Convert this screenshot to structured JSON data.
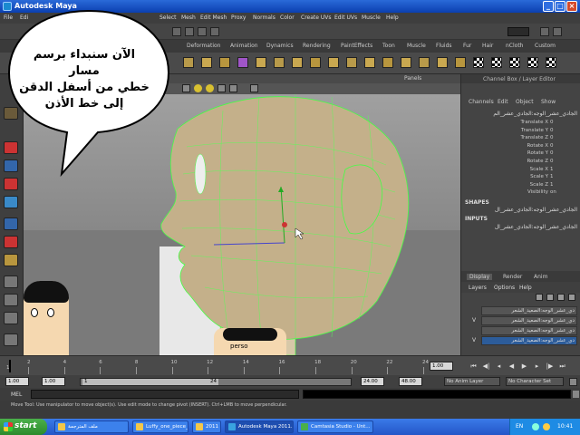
{
  "window": {
    "title": "Autodesk Maya"
  },
  "menu": [
    {
      "label": "File"
    },
    {
      "label": "Edi"
    },
    {
      "label": "Select"
    },
    {
      "label": "Mesh"
    },
    {
      "label": "Edit Mesh"
    },
    {
      "label": "Proxy"
    },
    {
      "label": "Normals"
    },
    {
      "label": "Color"
    },
    {
      "label": "Create UVs"
    },
    {
      "label": "Edit UVs"
    },
    {
      "label": "Muscle"
    },
    {
      "label": "Help"
    }
  ],
  "shelf_tabs": [
    {
      "label": "Deformation"
    },
    {
      "label": "Animation"
    },
    {
      "label": "Dynamics"
    },
    {
      "label": "Rendering"
    },
    {
      "label": "PaintEffects"
    },
    {
      "label": "Toon"
    },
    {
      "label": "Muscle"
    },
    {
      "label": "Fluids"
    },
    {
      "label": "Fur"
    },
    {
      "label": "Hair"
    },
    {
      "label": "nCloth"
    },
    {
      "label": "Custom"
    }
  ],
  "bubble": {
    "line1": "الآن سنبداء برسم مسار",
    "line2": "خطي من أسفل الدقن",
    "line3": "إلى خط الأذن"
  },
  "viewport": {
    "menu_label": "Panels",
    "poster_label": "perso"
  },
  "channel_box": {
    "title": "Channel Box / Layer Editor",
    "menu": [
      {
        "label": "Channels"
      },
      {
        "label": "Edit"
      },
      {
        "label": "Object"
      },
      {
        "label": "Show"
      }
    ],
    "node_name": "الجادي_عشر_الوجه:الجادي_عشر_الم",
    "attributes": [
      {
        "name": "Translate X",
        "value": "0"
      },
      {
        "name": "Translate Y",
        "value": "0"
      },
      {
        "name": "Translate Z",
        "value": "0"
      },
      {
        "name": "Rotate X",
        "value": "0"
      },
      {
        "name": "Rotate Y",
        "value": "0"
      },
      {
        "name": "Rotate Z",
        "value": "0"
      },
      {
        "name": "Scale X",
        "value": "1"
      },
      {
        "name": "Scale Y",
        "value": "1"
      },
      {
        "name": "Scale Z",
        "value": "1"
      },
      {
        "name": "Visibility",
        "value": "on"
      }
    ],
    "shapes_label": "SHAPES",
    "shape_name": "الجادي_عشر_الوجه:الجادي_عشر_ال",
    "inputs_label": "INPUTS",
    "input_name": "الجادي_عشر_الوجه:الجادي_عشر_ال"
  },
  "layer_editor": {
    "tabs": [
      {
        "label": "Display"
      },
      {
        "label": "Render"
      },
      {
        "label": "Anim"
      }
    ],
    "menu": [
      {
        "label": "Layers"
      },
      {
        "label": "Options"
      },
      {
        "label": "Help"
      }
    ],
    "layers": [
      {
        "name": "دي_عشر_الوجه:الصعيد_الشعر",
        "visible": ""
      },
      {
        "name": "دي_عشر_الوجه:الصعيد_الشعر",
        "visible": "V"
      },
      {
        "name": "دي_عشر_الوجه:الصعيد_الشعر",
        "visible": ""
      },
      {
        "name": "دي_عشر_الوجه:الصعيد_الشعر",
        "visible": "V"
      }
    ]
  },
  "timeline": {
    "ticks": [
      "2",
      "4",
      "6",
      "8",
      "10",
      "12",
      "14",
      "16",
      "18",
      "20",
      "22",
      "24"
    ],
    "current_frame": "1.00",
    "range_start": "1.00",
    "range_start_inner": "1.00",
    "range_thumb_start": "1",
    "range_thumb_end": "24",
    "range_end_inner": "24.00",
    "range_end": "48.00",
    "anim_layer": "No Anim Layer",
    "character_set": "No Character Set",
    "first_tick": "1"
  },
  "command_line": {
    "label": "MEL"
  },
  "help_line": {
    "text": "Move Tool: Use manipulator to move object(s). Use edit mode to change pivot (INSERT). Ctrl+LMB to move perpendicular."
  },
  "taskbar": {
    "start_label": "start",
    "tasks": [
      {
        "label": "ملف المترجمة",
        "color": "#f3c74a"
      },
      {
        "label": "Luffy_one_piece_ma...",
        "color": "#f3c74a"
      },
      {
        "label": "مايا 2011...",
        "color": "#f3c74a"
      },
      {
        "label": "Autodesk Maya 2011...",
        "color": "#39a3e0"
      },
      {
        "label": "Camtasia Studio - Unt...",
        "color": "#4ab04a"
      }
    ],
    "lang": "EN",
    "clock": "10:41"
  }
}
